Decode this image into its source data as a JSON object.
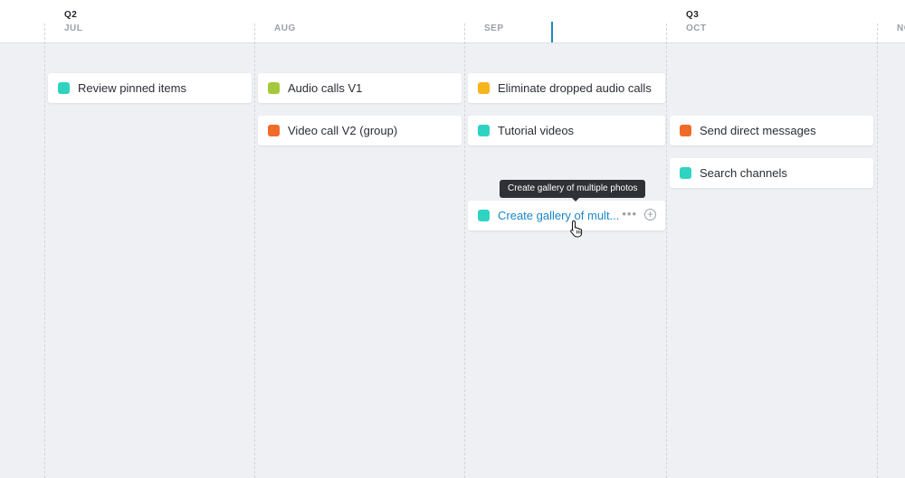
{
  "timeline": {
    "quarters": [
      "Q2",
      "Q3"
    ],
    "months": [
      "JUL",
      "AUG",
      "SEP",
      "OCT",
      "NOV"
    ]
  },
  "cards": [
    {
      "label": "Review pinned items",
      "color": "#2ed3c2"
    },
    {
      "label": "Audio calls V1",
      "color": "#a5c93c"
    },
    {
      "label": "Eliminate dropped audio calls",
      "color": "#f5b51c"
    },
    {
      "label": "Video call V2 (group)",
      "color": "#f06a28"
    },
    {
      "label": "Tutorial videos",
      "color": "#2ed3c2"
    },
    {
      "label": "Send direct messages",
      "color": "#f06a28"
    },
    {
      "label": "Search channels",
      "color": "#2ed3c2"
    },
    {
      "label": "Create gallery of mult...",
      "color": "#2ed3c2"
    }
  ],
  "hovered_card": {
    "more_icon": "more-horizontal-icon",
    "add_icon": "plus-circle-icon",
    "more_label": "•••",
    "add_label": "+"
  },
  "tooltip": {
    "text": "Create gallery of multiple photos"
  },
  "cursor": {
    "icon": "hand-pointer-icon"
  },
  "colors": {
    "accent": "#1a87c9",
    "today_marker": "#1f8ac2"
  }
}
